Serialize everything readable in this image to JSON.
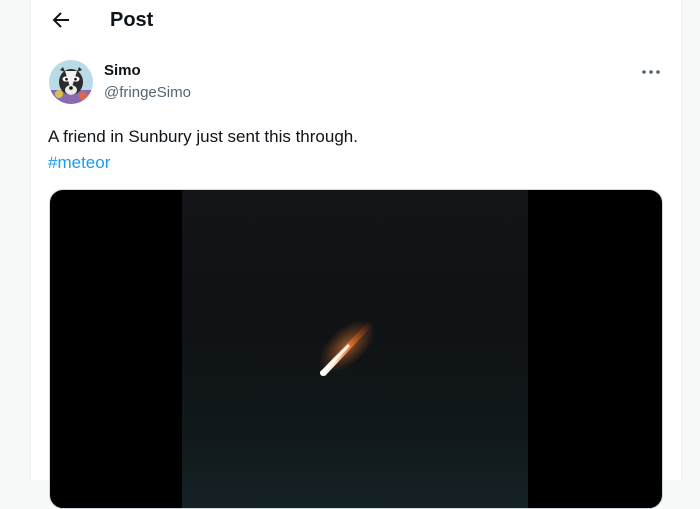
{
  "header": {
    "back_icon": "arrow-left-icon",
    "title": "Post"
  },
  "post": {
    "author": {
      "display_name": "Simo",
      "handle": "@fringeSimo",
      "avatar_icon": "badger-avatar"
    },
    "more_icon": "more-dots-icon",
    "text": "A friend in Sunbury just sent this through.",
    "hashtag": "#meteor",
    "media": {
      "type": "video",
      "description_icon": "meteor-streak"
    }
  },
  "colors": {
    "text_primary": "#0f1419",
    "text_secondary": "#536471",
    "link": "#1d9bf0",
    "border": "#eff3f4"
  }
}
